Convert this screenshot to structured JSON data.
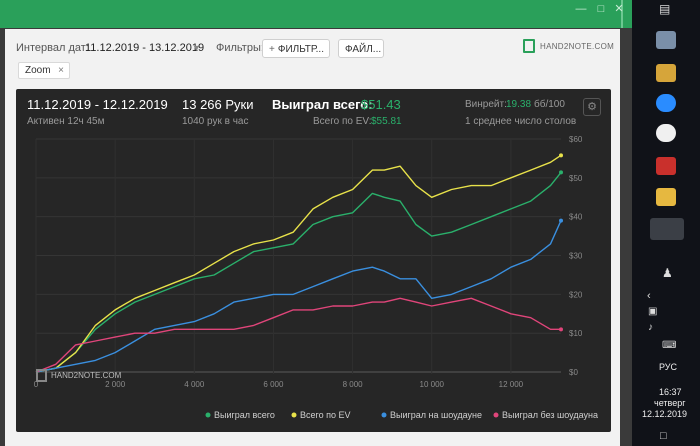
{
  "window": {
    "minimize_icon": "minimize-icon",
    "maximize_icon": "maximize-icon",
    "close_icon": "close-icon"
  },
  "filters": {
    "date_label": "Интервал дат:",
    "date_value": "11.12.2019 - 13.12.2019",
    "filters_label": "Фильтры:",
    "filter_button": "ФИЛЬТР...",
    "file_button": "ФАЙЛ...",
    "logo": "HAND2NOTE.COM",
    "zoom_chip": "Zoom"
  },
  "summary": {
    "date_range": "11.12.2019 - 12.12.2019",
    "active": "Активен 12ч 45м",
    "hands": "13 266 Руки",
    "per_hour": "1040 рук в час",
    "won_label": "Выиграл всего:",
    "won_value": "$51.43",
    "ev_label": "Всего по EV:",
    "ev_value": "$55.81",
    "winrate_label": "Винрейт:",
    "winrate_value": "19.38",
    "winrate_unit": "бб/100",
    "tables": "1 среднее число столов",
    "watermark": "HAND2NOTE.COM"
  },
  "chart_data": {
    "type": "line",
    "x_ticks": [
      "0",
      "2 000",
      "4 000",
      "6 000",
      "8 000",
      "10 000",
      "12 000"
    ],
    "y_ticks": [
      "$0",
      "$10",
      "$20",
      "$30",
      "$40",
      "$50",
      "$60"
    ],
    "xlim": [
      0,
      13266
    ],
    "ylim": [
      -0.5,
      60
    ],
    "grid": true,
    "legend_position": "bottom",
    "series": [
      {
        "name": "Выиграл всего",
        "color": "#2ab06b",
        "x": [
          0,
          500,
          1000,
          1500,
          2000,
          2500,
          3000,
          3500,
          4000,
          4500,
          5000,
          5500,
          6000,
          6500,
          7000,
          7500,
          8000,
          8500,
          8800,
          9200,
          9600,
          10000,
          10500,
          11000,
          11500,
          12000,
          12500,
          13000,
          13266
        ],
        "y": [
          0,
          1,
          5,
          11,
          15,
          18,
          20,
          22,
          24,
          25,
          28,
          31,
          32,
          33,
          38,
          40,
          41,
          46,
          45,
          44,
          38,
          35,
          36,
          38,
          40,
          42,
          44,
          48,
          51.4
        ]
      },
      {
        "name": "Всего по EV",
        "color": "#e8e24a",
        "x": [
          0,
          500,
          1000,
          1500,
          2000,
          2500,
          3000,
          3500,
          4000,
          4500,
          5000,
          5500,
          6000,
          6500,
          7000,
          7500,
          8000,
          8500,
          8800,
          9200,
          9600,
          10000,
          10500,
          11000,
          11500,
          12000,
          12500,
          13000,
          13266
        ],
        "y": [
          0,
          1,
          5,
          12,
          16,
          19,
          21,
          23,
          25,
          28,
          31,
          33,
          34,
          36,
          42,
          45,
          47,
          52,
          52,
          53,
          48,
          45,
          47,
          48,
          48,
          50,
          52,
          54,
          55.8
        ]
      },
      {
        "name": "Выиграл на шоудауне",
        "color": "#3a8fdf",
        "x": [
          0,
          500,
          1000,
          1500,
          2000,
          2500,
          3000,
          3500,
          4000,
          4500,
          5000,
          5500,
          6000,
          6500,
          7000,
          7500,
          8000,
          8500,
          8800,
          9200,
          9600,
          10000,
          10500,
          11000,
          11500,
          12000,
          12500,
          13000,
          13266
        ],
        "y": [
          0,
          1,
          2,
          3,
          5,
          8,
          11,
          12,
          13,
          15,
          18,
          19,
          20,
          20,
          22,
          24,
          26,
          27,
          26,
          24,
          24,
          19,
          20,
          22,
          24,
          27,
          29,
          33,
          39
        ]
      },
      {
        "name": "Выиграл без шоудауна",
        "color": "#e0457a",
        "x": [
          0,
          500,
          1000,
          1500,
          2000,
          2500,
          3000,
          3500,
          4000,
          4500,
          5000,
          5500,
          6000,
          6500,
          7000,
          7500,
          8000,
          8500,
          8800,
          9200,
          9600,
          10000,
          10500,
          11000,
          11500,
          12000,
          12500,
          13000,
          13266
        ],
        "y": [
          0,
          2,
          7,
          8,
          9,
          10,
          10,
          11,
          11,
          11,
          11,
          12,
          14,
          16,
          16,
          17,
          17,
          18,
          18,
          19,
          18,
          17,
          18,
          19,
          17,
          15,
          14,
          11,
          11
        ]
      }
    ]
  },
  "taskbar": {
    "lang": "РУС",
    "time": "16:37",
    "day": "четверг",
    "date": "12.12.2019"
  }
}
